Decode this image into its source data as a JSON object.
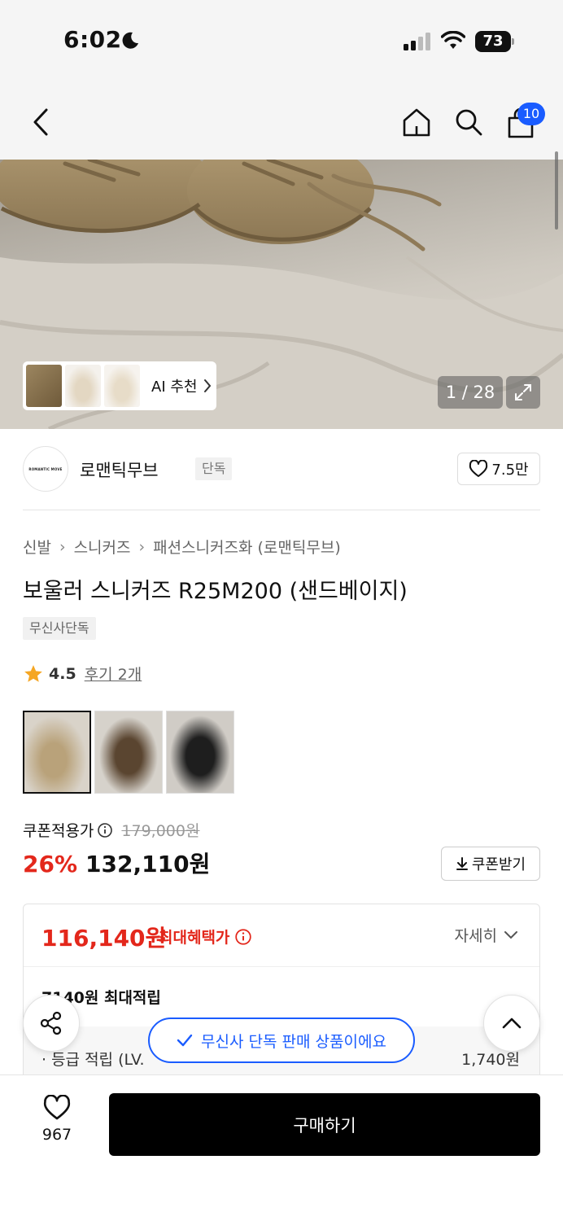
{
  "status": {
    "time": "6:02",
    "battery": "73"
  },
  "nav": {
    "cart_count": "10"
  },
  "gallery": {
    "ai_label": "AI 추천",
    "counter": "1 / 28"
  },
  "brand": {
    "logo_text": "ROMANTIC MOVE",
    "name": "로맨틱무브",
    "tag": "단독",
    "likes": "7.5만"
  },
  "breadcrumb": [
    "신발",
    "스니커즈",
    "패션스니커즈화 (로맨틱무브)"
  ],
  "product": {
    "title": "보울러 스니커즈 R25M200 (샌드베이지)",
    "tag": "무신사단독"
  },
  "rating": {
    "value": "4.5",
    "reviews": "후기 2개"
  },
  "color_options": [
    "sand-beige",
    "brown",
    "black"
  ],
  "price": {
    "coupon_label": "쿠폰적용가",
    "original": "179,000원",
    "discount": "26%",
    "sale": "132,110원",
    "coupon_button": "쿠폰받기"
  },
  "benefit": {
    "max_price": "116,140원",
    "max_label": "최대혜택가",
    "detail": "자세히",
    "max_point": "7140원 최대적립",
    "grade_label": "· 등급 적립 (LV.",
    "grade_value": "1,740원"
  },
  "toast": "무신사 단독 판매 상품이에요",
  "bottom": {
    "like_count": "967",
    "buy": "구매하기"
  },
  "colors": {
    "accent_blue": "#1a5cff",
    "sale_red": "#e3271b",
    "star": "#f5a623"
  }
}
